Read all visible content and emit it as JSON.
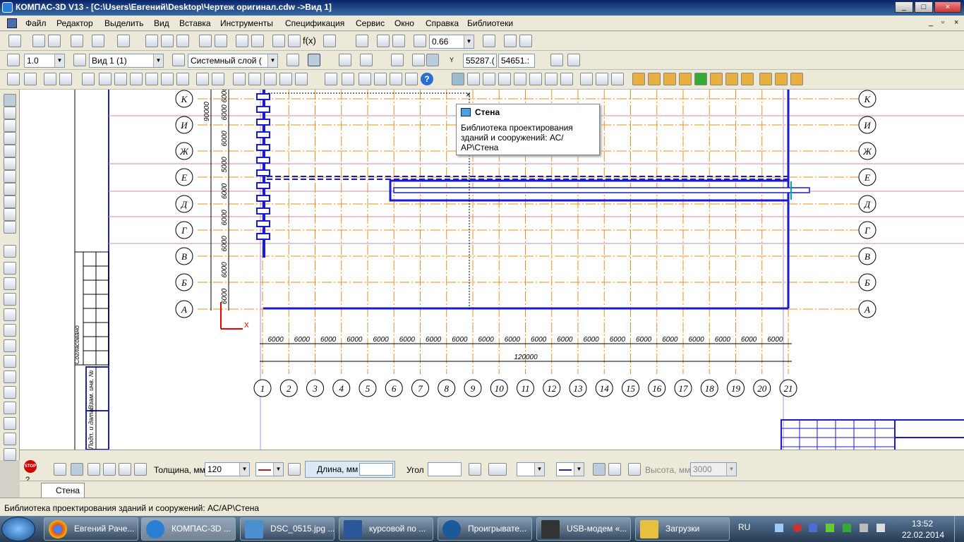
{
  "window": {
    "title": "КОМПАС-3D V13 - [C:\\Users\\Евгений\\Desktop\\Чертеж оригинал.cdw ->Вид 1]",
    "controls": [
      "_",
      "□",
      "×"
    ]
  },
  "menu": {
    "items": [
      "Файл",
      "Редактор",
      "Выделить",
      "Вид",
      "Вставка",
      "Инструменты",
      "Спецификация",
      "Сервис",
      "Окно",
      "Справка",
      "Библиотеки"
    ],
    "mdi_controls": [
      "_",
      "▫",
      "×"
    ]
  },
  "toolbar1": {
    "zoom_value": "0.66"
  },
  "toolbar2": {
    "scale_value": "1.0",
    "view_value": "Вид 1 (1)",
    "layer_value": "Системный слой (",
    "coord_x": "55287.(",
    "coord_y": "54651.:"
  },
  "tooltip": {
    "title": "Стена",
    "body": "Библиотека проектирования зданий и сооружений: АС/АР\\Стена"
  },
  "drawing": {
    "row_axes": [
      "К",
      "И",
      "Ж",
      "Е",
      "Д",
      "Г",
      "В",
      "Б",
      "А"
    ],
    "column_axes": [
      "1",
      "2",
      "3",
      "4",
      "5",
      "6",
      "7",
      "8",
      "9",
      "10",
      "11",
      "12",
      "13",
      "14",
      "15",
      "16",
      "17",
      "18",
      "19",
      "20",
      "21"
    ],
    "span_dims": [
      "6000",
      "6000",
      "6000",
      "6000",
      "6000",
      "6000",
      "6000",
      "6000",
      "6000",
      "6000",
      "6000",
      "6000",
      "6000",
      "6000",
      "6000",
      "6000",
      "6000",
      "6000",
      "6000",
      "6000"
    ],
    "total_dim": "120000",
    "vert_total_dim": "90000",
    "vert_dims": [
      "6000",
      "6000",
      "6000",
      "5000",
      "6000",
      "6000",
      "6000",
      "6000",
      "6000"
    ],
    "stamp_labels": [
      "Согласовано",
      "Взам. инв. №",
      "Подп. и дата"
    ],
    "axis_label_x": "X"
  },
  "props": {
    "thickness_label": "Толщина, мм",
    "thickness_value": "120",
    "length_label": "Длина, мм",
    "length_value": "",
    "angle_label": "Угол",
    "angle_value": "",
    "height_label": "Высота, мм",
    "height_value": "3000",
    "stop_label": "STOP"
  },
  "tabs": {
    "active": "Стена"
  },
  "status": {
    "text": "Библиотека проектирования зданий и сооружений: АС/АР\\Стена"
  },
  "taskbar": {
    "tasks": [
      "Евгений Раче...",
      "КОМПАС-3D ...",
      "DSC_0515.jpg ...",
      "курсовой по ...",
      "Проигрывате...",
      "USB-модем «...",
      "Загрузки"
    ],
    "lang": "RU",
    "time": "13:52",
    "date": "22.02.2014"
  }
}
